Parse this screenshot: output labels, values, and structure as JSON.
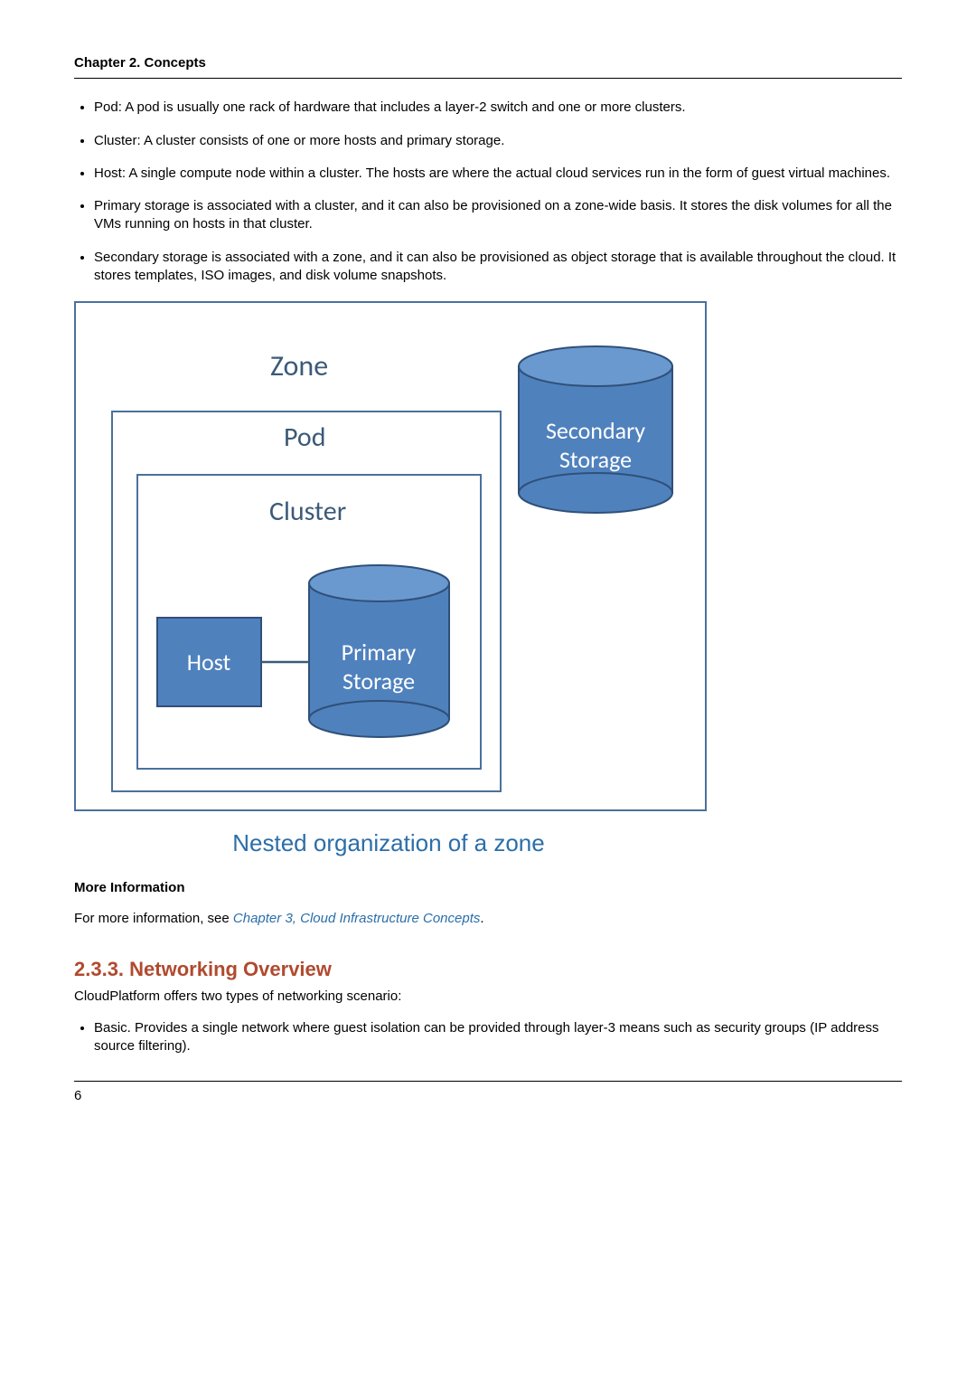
{
  "header": {
    "chapter": "Chapter 2. Concepts"
  },
  "bullets": [
    "Pod: A pod is usually one rack of hardware that includes a layer-2 switch and one or more clusters.",
    "Cluster: A cluster consists of one or more hosts and primary storage.",
    "Host: A single compute node within a cluster. The hosts are where the actual cloud services run in the form of guest virtual machines.",
    "Primary storage is associated with a cluster, and it can also be provisioned on a zone-wide basis. It stores the disk volumes for all the VMs running on hosts in that cluster.",
    "Secondary storage is associated with a zone, and it can also be provisioned as object storage that is available throughout the cloud. It stores templates, ISO images, and disk volume snapshots."
  ],
  "diagram": {
    "zone": "Zone",
    "pod": "Pod",
    "cluster": "Cluster",
    "host": "Host",
    "primary_storage_l1": "Primary",
    "primary_storage_l2": "Storage",
    "secondary_storage_l1": "Secondary",
    "secondary_storage_l2": "Storage",
    "caption": "Nested organization of a zone"
  },
  "more_info": {
    "heading": "More Information",
    "prefix": "For more information, see ",
    "link": "Chapter 3, Cloud Infrastructure Concepts",
    "suffix": "."
  },
  "section": {
    "number_title": "2.3.3. Networking Overview",
    "intro": "CloudPlatform offers two types of networking scenario:",
    "item1": "Basic. Provides a single network where guest isolation can be provided through layer-3 means such as security groups (IP address source filtering)."
  },
  "footer": {
    "page_number": "6"
  }
}
